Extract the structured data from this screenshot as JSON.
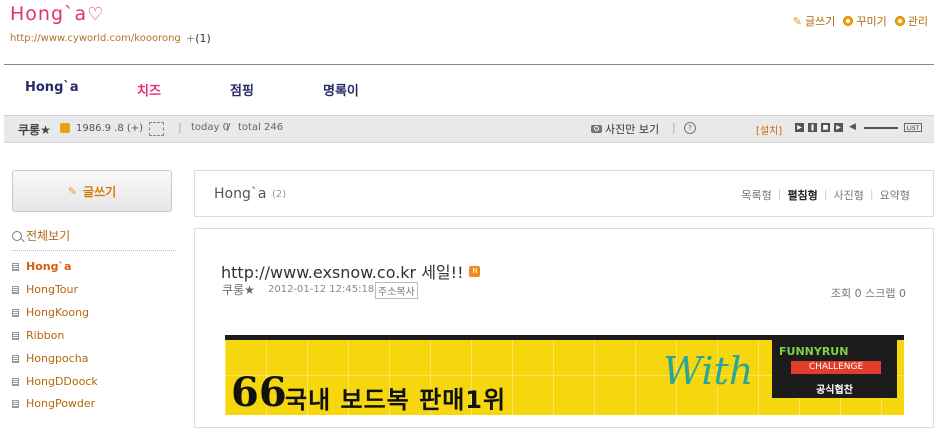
{
  "header": {
    "logo_text": "Hong`a",
    "logo_heart": "♡",
    "url": "http://www.cyworld.com/kooorong",
    "plus_label": "+",
    "plus_count": "(1)",
    "links": {
      "write": "글쓰기",
      "decorate": "꾸미기",
      "manage": "관리"
    }
  },
  "menu": [
    {
      "label": "Hong`a"
    },
    {
      "label": "치즈"
    },
    {
      "label": "점핑"
    },
    {
      "label": "명록이"
    }
  ],
  "info_bar": {
    "name": "쿠롱★",
    "birth": "1986.9 .8 (+)",
    "sep": "|",
    "today": "today 0",
    "divider": "/",
    "total": "total 246",
    "photo_only": "사진만 보기",
    "install": "[설치]",
    "list": "LIST"
  },
  "sidebar": {
    "write_label": "글쓰기",
    "view_all": "전체보기",
    "categories": [
      {
        "label": "Hong`a",
        "selected": true
      },
      {
        "label": "HongTour"
      },
      {
        "label": "HongKoong"
      },
      {
        "label": "Ribbon"
      },
      {
        "label": "Hongpocha"
      },
      {
        "label": "HongDDoock"
      },
      {
        "label": "HongPowder"
      }
    ]
  },
  "folder": {
    "title": "Hong`a",
    "count": "(2)",
    "view_modes": [
      "목록형",
      "펼침형",
      "사진형",
      "요약형"
    ],
    "active_view": "펼침형"
  },
  "post": {
    "title": "http://www.exsnow.co.kr 세일!!",
    "new_badge": "N",
    "author": "쿠롱★",
    "time": "2012-01-12 12:45:18",
    "copy_address": "주소복사",
    "stats": "조회 0  스크랩 0"
  },
  "banner": {
    "quote": "66",
    "headline": "국내 보드복 판매1위",
    "with": "With",
    "logo_line1": "FUNNYRUN",
    "logo_line2": "CHALLENGE",
    "logo_line3": "공식협찬"
  },
  "colors": {
    "brand_pink": "#e0307a",
    "link_orange": "#b5670d",
    "banner_yellow": "#f6d60c"
  }
}
